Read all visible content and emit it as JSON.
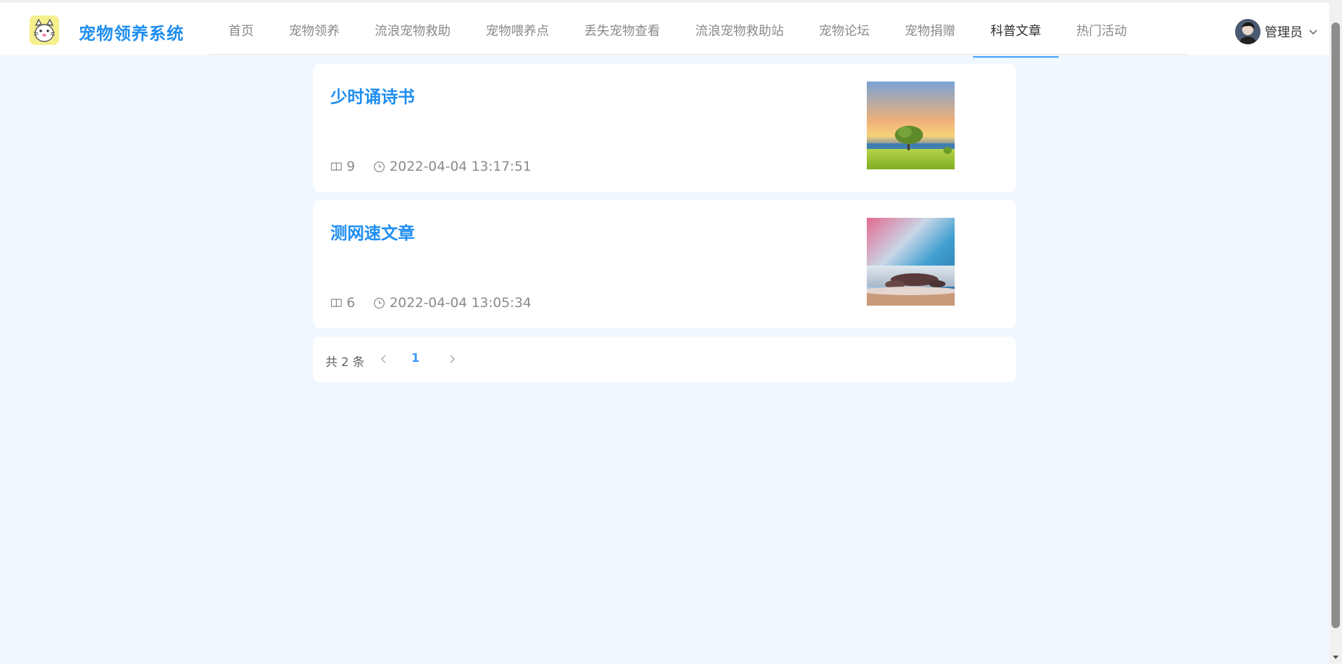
{
  "header": {
    "brand": "宠物领养系统",
    "nav": [
      "首页",
      "宠物领养",
      "流浪宠物救助",
      "宠物喂养点",
      "丢失宠物查看",
      "流浪宠物救助站",
      "宠物论坛",
      "宠物捐赠",
      "科普文章",
      "热门活动"
    ],
    "active_nav": "科普文章",
    "user": "管理员"
  },
  "articles": [
    {
      "title": "少时诵诗书",
      "views": "9",
      "time": "2022-04-04 13:17:51"
    },
    {
      "title": "测网速文章",
      "views": "6",
      "time": "2022-04-04 13:05:34"
    }
  ],
  "pager": {
    "total": "共 2 条",
    "current": "1"
  },
  "colors": {
    "accent": "#1f8ef1",
    "background": "#f0f7ff",
    "active_underline": "#409eff"
  }
}
